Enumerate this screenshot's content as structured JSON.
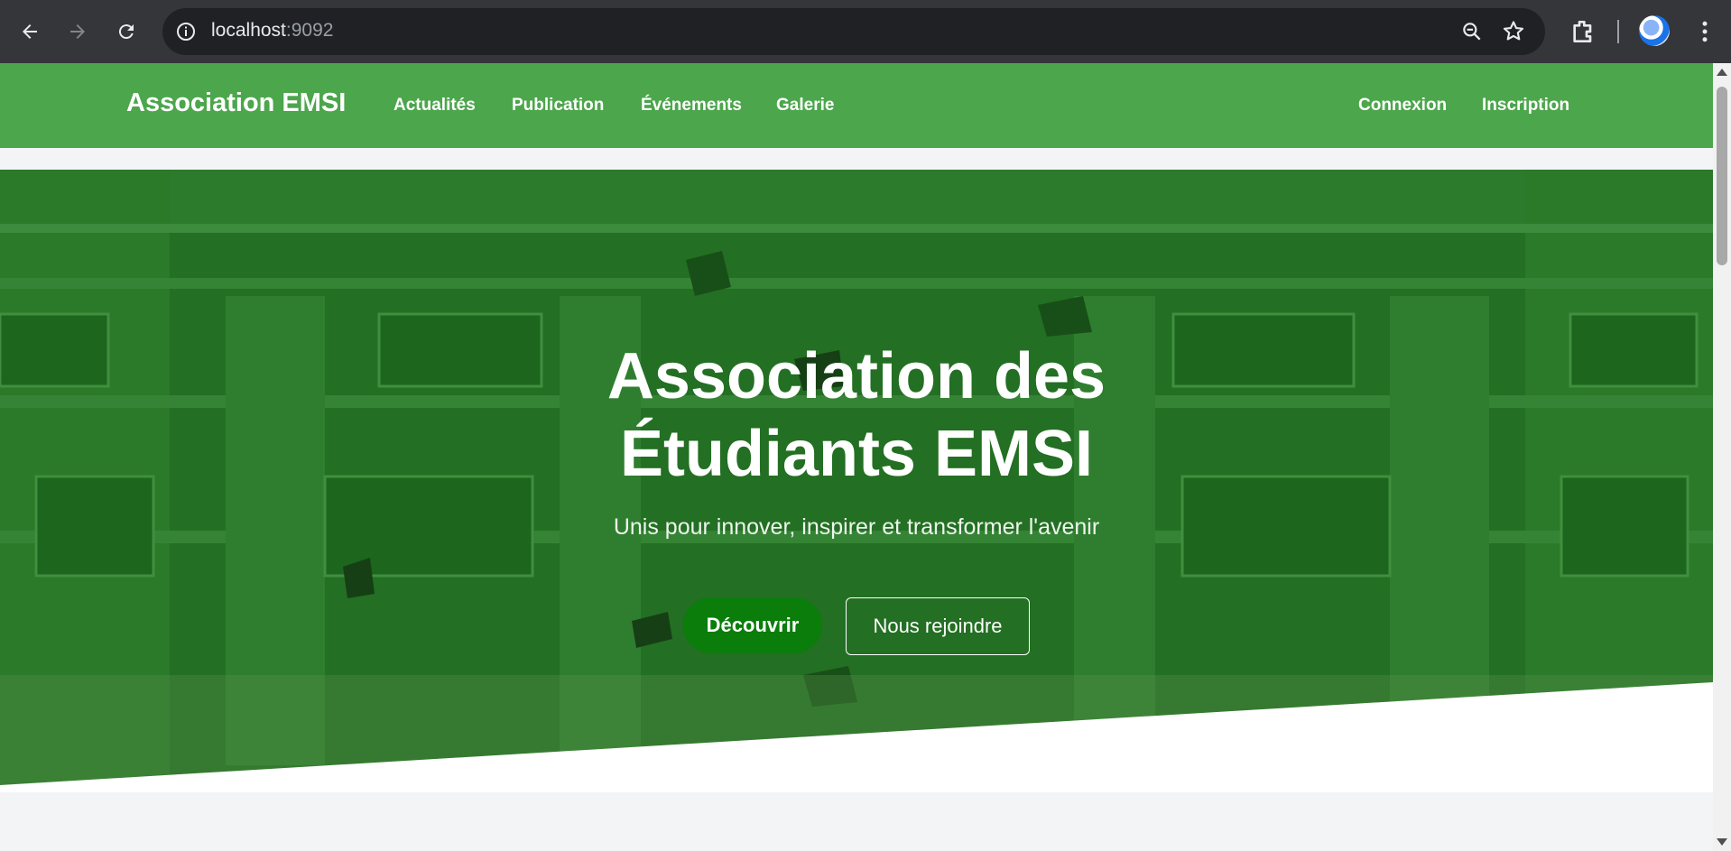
{
  "browser": {
    "url_host": "localhost",
    "url_port": ":9092",
    "icons": [
      "back-icon",
      "forward-icon",
      "reload-icon",
      "info-icon",
      "zoom-icon",
      "star-icon",
      "extensions-icon",
      "profile-icon",
      "menu-icon"
    ]
  },
  "navbar": {
    "brand": "Association EMSI",
    "links": [
      "Actualités",
      "Publication",
      "Événements",
      "Galerie"
    ],
    "auth": [
      "Connexion",
      "Inscription"
    ]
  },
  "hero": {
    "title_line1": "Association des",
    "title_line2": "Étudiants EMSI",
    "subtitle": "Unis pour innover, inspirer et transformer l'avenir",
    "primary_button": "Découvrir",
    "secondary_button": "Nous rejoindre"
  },
  "colors": {
    "navbar": "#4ca64c",
    "hero_overlay": "#1f6d1f",
    "primary_button": "#0a7d0a"
  }
}
